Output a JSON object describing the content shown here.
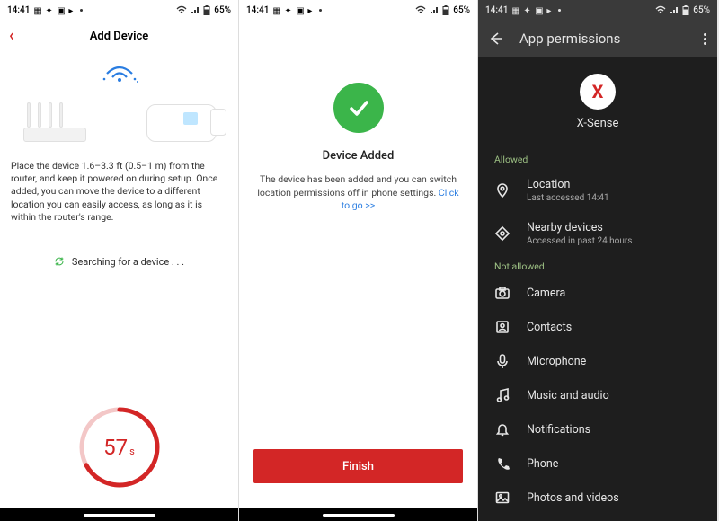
{
  "status": {
    "time": "14:41",
    "battery": "65%"
  },
  "screen1": {
    "header_title": "Add Device",
    "instructions": "Place the device 1.6–3.3 ft (0.5–1 m) from the router, and keep it powered on during setup. Once added, you can move the device to a different location you can easily access, as long as it is within the router's range.",
    "searching_label": "Searching for a device . . .",
    "countdown_value": "57",
    "countdown_unit": "s",
    "countdown_fraction": 0.67
  },
  "screen2": {
    "title": "Device Added",
    "message_prefix": "The device has been added and you can switch location permissions off in phone settings. ",
    "link_text": "Click to go >>",
    "finish_label": "Finish"
  },
  "screen3": {
    "header_title": "App permissions",
    "app_name": "X-Sense",
    "app_initial": "X",
    "section_allowed": "Allowed",
    "section_not_allowed": "Not allowed",
    "allowed": [
      {
        "icon": "location",
        "name": "Location",
        "sub": "Last accessed 14:41"
      },
      {
        "icon": "nearby",
        "name": "Nearby devices",
        "sub": "Accessed in past 24 hours"
      }
    ],
    "not_allowed": [
      {
        "icon": "camera",
        "name": "Camera"
      },
      {
        "icon": "contacts",
        "name": "Contacts"
      },
      {
        "icon": "mic",
        "name": "Microphone"
      },
      {
        "icon": "music",
        "name": "Music and audio"
      },
      {
        "icon": "bell",
        "name": "Notifications"
      },
      {
        "icon": "phone",
        "name": "Phone"
      },
      {
        "icon": "photos",
        "name": "Photos and videos"
      }
    ]
  }
}
